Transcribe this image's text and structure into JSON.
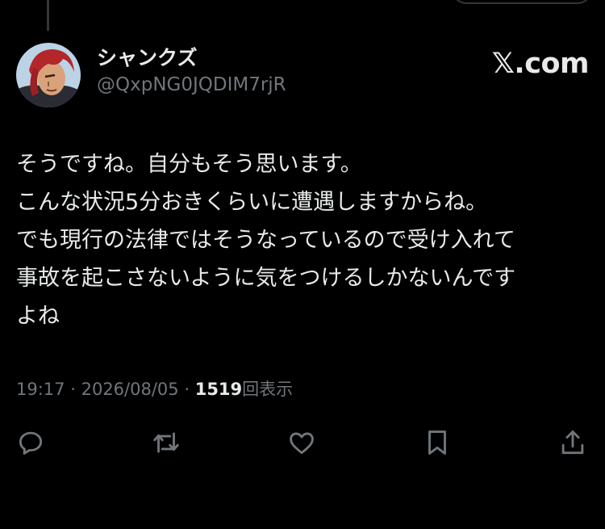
{
  "post": {
    "display_name": "シャンクズ",
    "handle": "@QxpNG0JQDIM7rjR",
    "brand": "𝕏.com",
    "text_lines": [
      "そうですね。自分もそう思います。",
      "こんな状況5分おきくらいに遭遇しますからね。",
      "でも現行の法律ではそうなっているので受け入れて",
      "事故を起こさないように気をつけるしかないんです",
      "よね"
    ],
    "time": "19:17",
    "separator": "·",
    "date": "2026/08/05",
    "views_count": "1519",
    "views_label": "回表示"
  },
  "actions": {
    "reply_icon": "reply-icon",
    "repost_icon": "repost-icon",
    "like_icon": "like-icon",
    "bookmark_icon": "bookmark-icon",
    "share_icon": "share-icon"
  },
  "colors": {
    "background": "#000000",
    "primary_text": "#e7e9ea",
    "secondary_text": "#71767b",
    "divider": "#333639"
  }
}
